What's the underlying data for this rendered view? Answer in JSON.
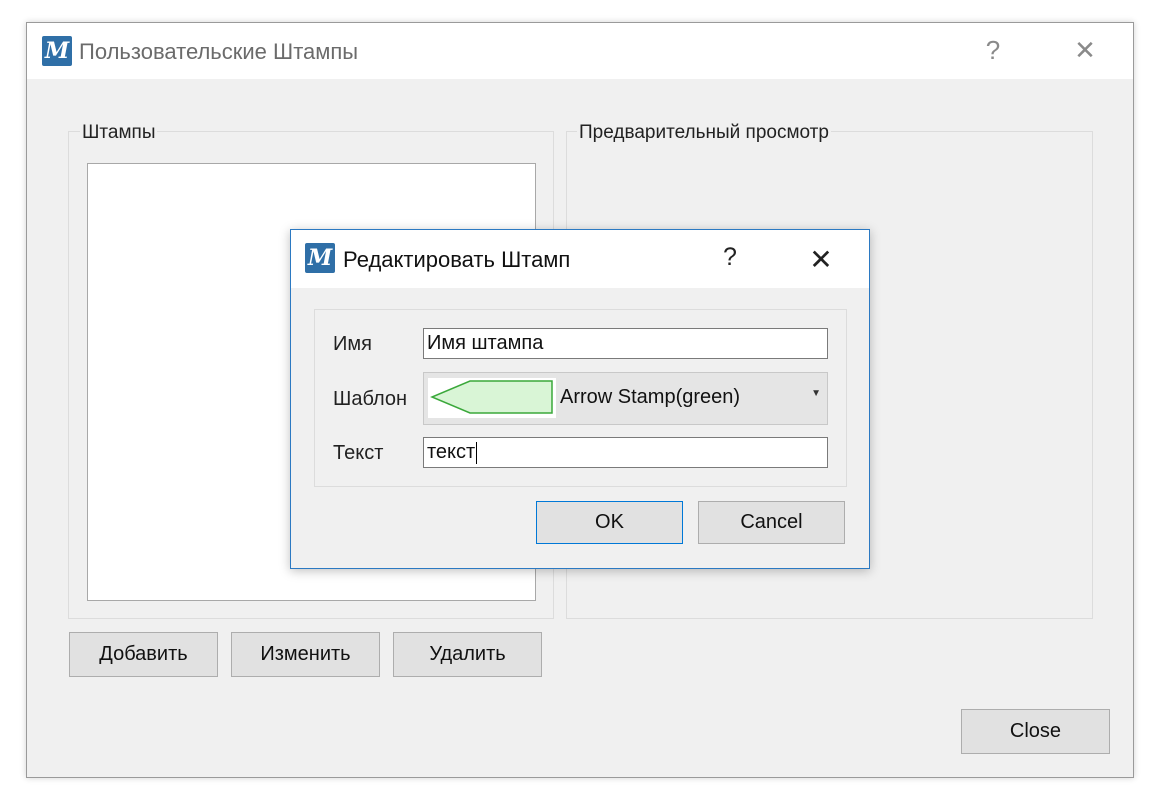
{
  "main_window": {
    "title": "Пользовательские Штампы",
    "logo_letter": "M",
    "help_glyph": "?",
    "close_glyph": "✕",
    "stamps_group_title": "Штампы",
    "preview_group_title": "Предварительный просмотр",
    "buttons": {
      "add": "Добавить",
      "edit": "Изменить",
      "delete": "Удалить",
      "close": "Close"
    }
  },
  "edit_dialog": {
    "title": "Редактировать Штамп",
    "logo_letter": "M",
    "help_glyph": "?",
    "close_glyph": "✕",
    "name_label": "Имя",
    "name_value": "Имя штампа",
    "template_label": "Шаблон",
    "template_value": "Arrow Stamp(green)",
    "text_label": "Текст",
    "text_value": "текст",
    "ok_label": "OK",
    "cancel_label": "Cancel",
    "combo_arrow_icon": "chevron-down-icon"
  },
  "colors": {
    "logo_bg": "#2f6fa7",
    "dialog_border": "#2b79c2",
    "stamp_fill": "#d9f5d6",
    "stamp_stroke": "#3aa83a"
  }
}
